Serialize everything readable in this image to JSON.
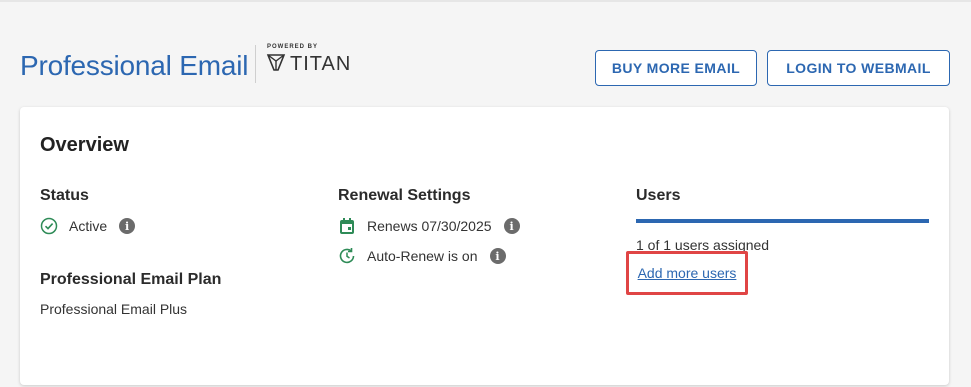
{
  "header": {
    "title": "Professional Email",
    "powered_by": "POWERED BY",
    "brand": "TITAN",
    "buy_button": "BUY MORE EMAIL",
    "login_button": "LOGIN TO WEBMAIL"
  },
  "overview": {
    "heading": "Overview",
    "status": {
      "label": "Status",
      "value": "Active",
      "icon": "check-circle-icon"
    },
    "plan": {
      "label": "Professional Email Plan",
      "value": "Professional Email Plus"
    },
    "renewal": {
      "label": "Renewal Settings",
      "renews": "Renews 07/30/2025",
      "auto_renew": "Auto-Renew is on"
    },
    "users": {
      "label": "Users",
      "assigned": "1 of 1 users assigned",
      "add_link": "Add more users"
    }
  },
  "colors": {
    "brand_blue": "#2c67b1",
    "success_green": "#2e8b57",
    "highlight_red": "#e04545"
  }
}
